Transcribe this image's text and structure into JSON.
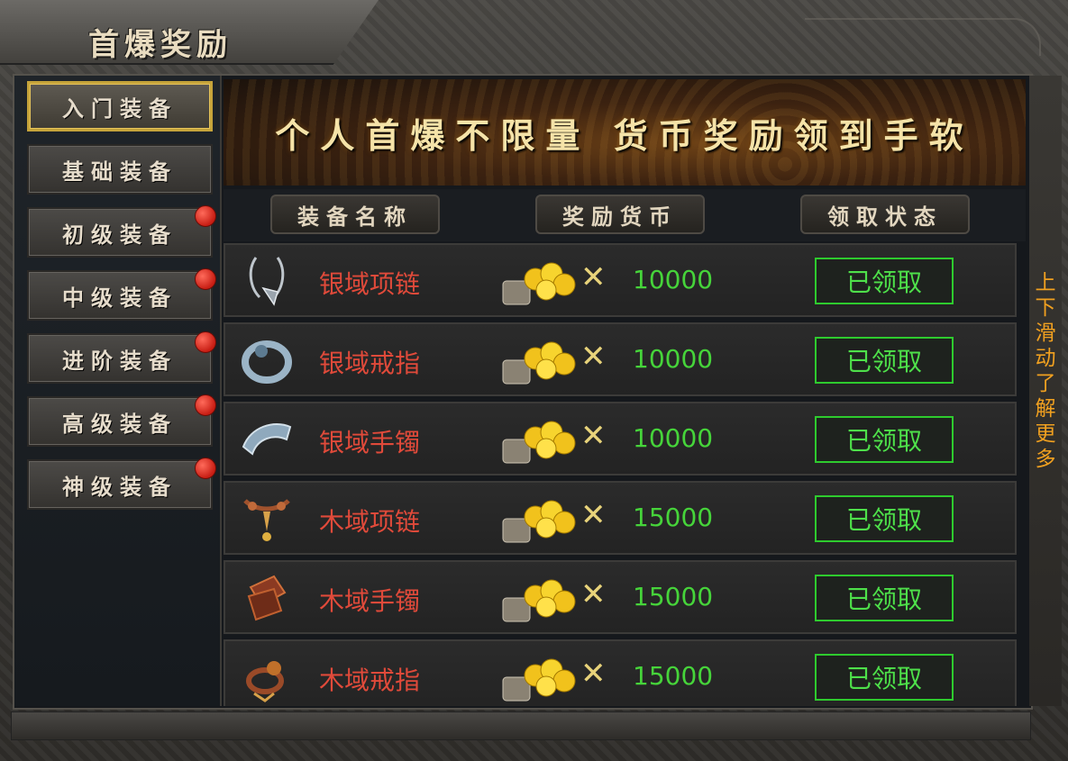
{
  "window": {
    "title": "首爆奖励"
  },
  "sidebar": {
    "tabs": [
      {
        "label": "入门装备",
        "active": true,
        "badge": false
      },
      {
        "label": "基础装备",
        "active": false,
        "badge": false
      },
      {
        "label": "初级装备",
        "active": false,
        "badge": true
      },
      {
        "label": "中级装备",
        "active": false,
        "badge": true
      },
      {
        "label": "进阶装备",
        "active": false,
        "badge": true
      },
      {
        "label": "高级装备",
        "active": false,
        "badge": true
      },
      {
        "label": "神级装备",
        "active": false,
        "badge": true
      }
    ]
  },
  "banner": {
    "text": "个人首爆不限量 货币奖励领到手软"
  },
  "table": {
    "headers": [
      "装备名称",
      "奖励货币",
      "领取状态"
    ],
    "multiply_symbol": "✕",
    "rows": [
      {
        "name": "银域项链",
        "icon": "necklace-icon",
        "amount": "10000",
        "status": "已领取"
      },
      {
        "name": "银域戒指",
        "icon": "ring-icon",
        "amount": "10000",
        "status": "已领取"
      },
      {
        "name": "银域手镯",
        "icon": "bracelet-icon",
        "amount": "10000",
        "status": "已领取"
      },
      {
        "name": "木域项链",
        "icon": "necklace-icon",
        "amount": "15000",
        "status": "已领取"
      },
      {
        "name": "木域手镯",
        "icon": "bracelet-icon",
        "amount": "15000",
        "status": "已领取"
      },
      {
        "name": "木域戒指",
        "icon": "ring-icon",
        "amount": "15000",
        "status": "已领取"
      }
    ]
  },
  "scroll_hint": "上下滑动了解更多",
  "colors": {
    "item_name": "#e04a3a",
    "amount": "#46d43a",
    "status": "#4ee04a",
    "accent_gold": "#c5a33a"
  }
}
